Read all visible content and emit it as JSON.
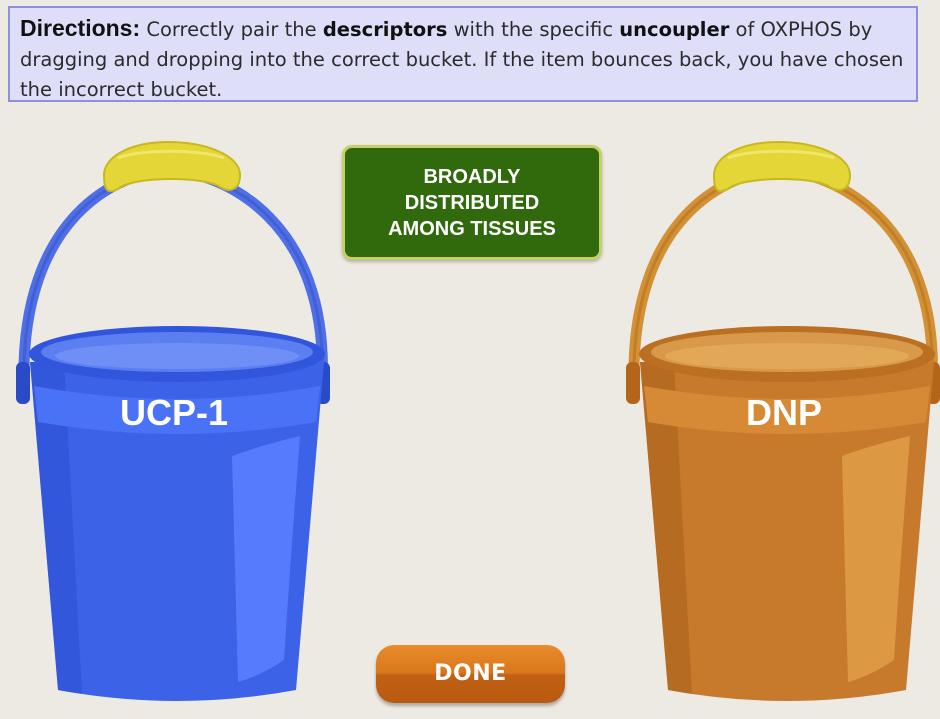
{
  "directions": {
    "lead": "Directions:",
    "part1": " Correctly pair the ",
    "bold1": "descriptors",
    "part2": " with the specific ",
    "bold2": "uncoupler",
    "part3": " of OXPHOS by dragging and dropping into the correct bucket. If the item bounces back, you have chosen the incorrect bucket."
  },
  "drag_item": {
    "line1": "BROADLY",
    "line2": "DISTRIBUTED",
    "line3": "AMONG TISSUES"
  },
  "buckets": [
    {
      "label": "UCP-1",
      "color": "#3a64ee"
    },
    {
      "label": "DNP",
      "color": "#d0822e"
    }
  ],
  "done_button": {
    "label": "DONE"
  }
}
